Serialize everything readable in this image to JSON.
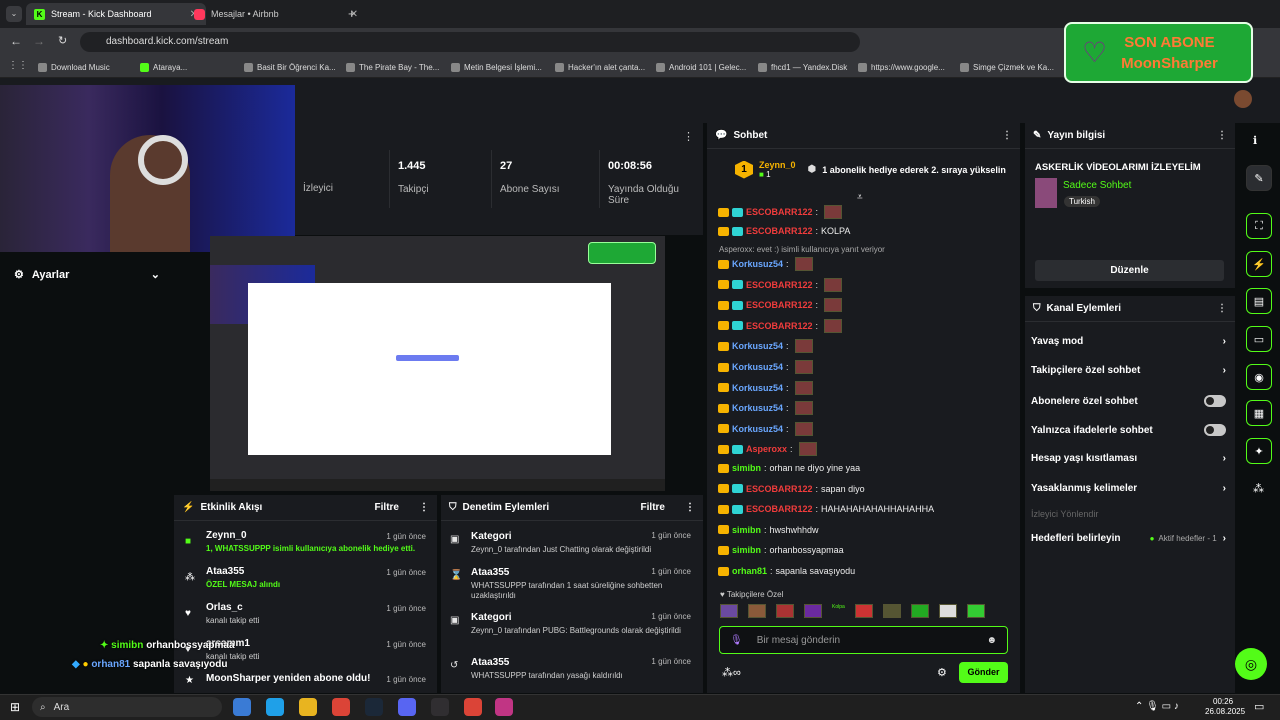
{
  "browser": {
    "tabs": [
      {
        "label": "Stream - Kick Dashboard",
        "active": true
      },
      {
        "label": "Mesajlar • Airbnb",
        "active": false
      }
    ],
    "url": "dashboard.kick.com/stream",
    "bookmarks": [
      "Download Music",
      "Ataraya...",
      "Basit Bir Öğrenci Ka...",
      "The Pirate Bay - The...",
      "Metin Belgesi İşlemi...",
      "Hacker'ın alet çanta...",
      "Android 101 | Gelec...",
      "fhcd1 — Yandex.Disk",
      "https://www.google...",
      "Simge Çizmek ve Ka..."
    ]
  },
  "overlay": {
    "son_abone_label": "SON ABONE",
    "son_abone_name": "MoonSharper",
    "chat_overlay": [
      {
        "user": "simibn",
        "text": "orhanbossyapmaa"
      },
      {
        "user": "orhan81",
        "text": "sapanla savaşıyodu"
      }
    ]
  },
  "sidebar": {
    "settings_label": "Ayarlar"
  },
  "stats": [
    {
      "value": "",
      "label": "İzleyici"
    },
    {
      "value": "1.445",
      "label": "Takipçi"
    },
    {
      "value": "27",
      "label": "Abone Sayısı"
    },
    {
      "value": "00:08:56",
      "label": "Yayında Olduğu Süre"
    }
  ],
  "activity_feed": {
    "title": "Etkinlik Akışı",
    "filter": "Filtre",
    "items": [
      {
        "title": "Zeynn_0",
        "desc": "1, WHATSSUPPP isimli kullanıcıya abonelik hediye etti.",
        "time": "1 gün önce"
      },
      {
        "title": "Ataa355",
        "desc": "ÖZEL MESAJ alındı",
        "time": "1 gün önce"
      },
      {
        "title": "Orlas_c",
        "desc": "kanalı takip etti",
        "time": "1 gün önce"
      },
      {
        "title": "arsamm1",
        "desc": "kanalı takip etti",
        "time": "1 gün önce"
      },
      {
        "title": "MoonSharper yeniden abone oldu!",
        "desc": "",
        "time": "1 gün önce"
      }
    ]
  },
  "mod_actions": {
    "title": "Denetim Eylemleri",
    "filter": "Filtre",
    "items": [
      {
        "title": "Kategori",
        "desc": "Zeynn_0 tarafından Just Chatting olarak değiştirildi",
        "time": "1 gün önce"
      },
      {
        "title": "Ataa355",
        "desc": "WHATSSUPPP tarafından 1 saat süreliğine sohbetten uzaklaştırıldı",
        "time": "1 gün önce"
      },
      {
        "title": "Kategori",
        "desc": "Zeynn_0 tarafından PUBG: Battlegrounds olarak değiştirildi",
        "time": "1 gün önce"
      },
      {
        "title": "Ataa355",
        "desc": "WHATSSUPPP tarafından yasağı kaldırıldı",
        "time": "1 gün önce"
      }
    ]
  },
  "chat": {
    "title": "Sohbet",
    "pinned_user": "Zeynn_0",
    "pinned_count": "1",
    "pinned_text": "1 abonelik hediye ederek 2. sıraya yükselin",
    "messages": [
      {
        "user": "ESCOBARR122",
        "text": "",
        "color": "red"
      },
      {
        "user": "ESCOBARR122",
        "text": "KOLPA",
        "color": "red"
      },
      {
        "user": "Korkusuz54",
        "text": "",
        "color": "blue",
        "reply": "Asperoxx: evet :) isimli kullanıcıya yanıt veriyor"
      },
      {
        "user": "ESCOBARR122",
        "text": "",
        "color": "red"
      },
      {
        "user": "ESCOBARR122",
        "text": "",
        "color": "red"
      },
      {
        "user": "ESCOBARR122",
        "text": "",
        "color": "red"
      },
      {
        "user": "Korkusuz54",
        "text": "",
        "color": "blue"
      },
      {
        "user": "Korkusuz54",
        "text": "",
        "color": "blue"
      },
      {
        "user": "Korkusuz54",
        "text": "",
        "color": "blue"
      },
      {
        "user": "Korkusuz54",
        "text": "",
        "color": "blue"
      },
      {
        "user": "Korkusuz54",
        "text": "",
        "color": "blue"
      },
      {
        "user": "Asperoxx",
        "text": "",
        "color": "red"
      },
      {
        "user": "simibn",
        "text": "orhan ne diyo yine yaa",
        "color": "green"
      },
      {
        "user": "ESCOBARR122",
        "text": "sapan diyo",
        "color": "red"
      },
      {
        "user": "ESCOBARR122",
        "text": "HAHAHAHAHAHHAHAHHA",
        "color": "red"
      },
      {
        "user": "simibn",
        "text": "hwshwhhdw",
        "color": "green"
      },
      {
        "user": "simibn",
        "text": "orhanbossyapmaa",
        "color": "green"
      },
      {
        "user": "orhan81",
        "text": "sapanla savaşıyodu",
        "color": "green"
      }
    ],
    "followers_only_label": "Takipçilere Özel",
    "kolpa_label": "Kolpa",
    "input_placeholder": "Bir mesaj gönderin",
    "send_label": "Gönder"
  },
  "stream_info": {
    "title": "Yayın bilgisi",
    "stream_title": "ASKERLİK VİDEOLARIMI İZLEYELİM",
    "category": "Sadece Sohbet",
    "language": "Turkish",
    "edit_label": "Düzenle"
  },
  "channel_actions": {
    "title": "Kanal Eylemleri",
    "items": [
      {
        "label": "Yavaş mod",
        "kind": "chevron"
      },
      {
        "label": "Takipçilere özel sohbet",
        "kind": "chevron"
      },
      {
        "label": "Abonelere özel sohbet",
        "kind": "toggle"
      },
      {
        "label": "Yalnızca ifadelerle sohbet",
        "kind": "toggle"
      },
      {
        "label": "Hesap yaşı kısıtlaması",
        "kind": "chevron"
      },
      {
        "label": "Yasaklanmış kelimeler",
        "kind": "chevron"
      }
    ],
    "viewer_redirect_label": "İzleyici Yönlendir",
    "set_targets_label": "Hedefleri belirleyin",
    "active_targets": "Aktif hedefler - 1"
  },
  "taskbar": {
    "search_label": "Ara",
    "time": "00:26",
    "date": "26.08.2025"
  },
  "colors": {
    "accent": "#53fc18",
    "panel": "#191b1f",
    "bg": "#0b0e0f"
  }
}
